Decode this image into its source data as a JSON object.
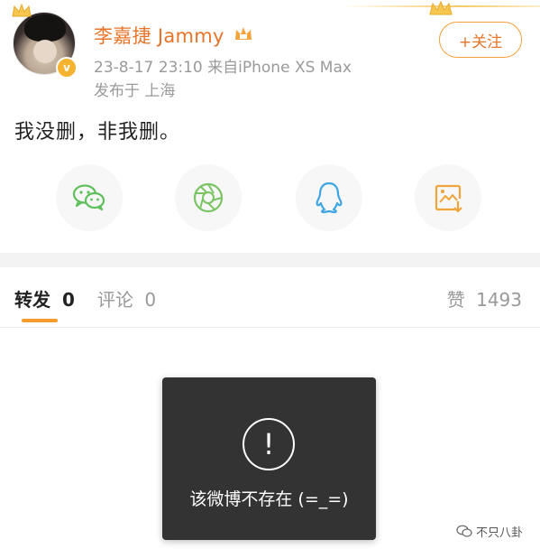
{
  "post": {
    "username": "李嘉捷 Jammy",
    "date_time": "23-8-17 23:10",
    "source": "来自iPhone XS Max",
    "location": "发布于 上海",
    "follow_label": "+关注",
    "content": "我没删，非我删。"
  },
  "share": {
    "items": [
      {
        "icon": "wechat-icon",
        "color": "#5fbf5a"
      },
      {
        "icon": "moments-icon",
        "color": "#7bc463"
      },
      {
        "icon": "qq-icon",
        "color": "#3fa6e2"
      },
      {
        "icon": "save-image-icon",
        "color": "#f0a53a"
      }
    ]
  },
  "tabs": {
    "repost": {
      "label": "转发",
      "count": "0"
    },
    "comment": {
      "label": "评论",
      "count": "0"
    },
    "like": {
      "label": "赞",
      "count": "1493"
    }
  },
  "toast": {
    "icon": "!",
    "message": "该微博不存在 (=_=)"
  },
  "watermark": {
    "text": "不只八卦"
  },
  "colors": {
    "accent": "#e8742a",
    "tab_indicator": "#f59c2f",
    "toast_bg": "#333333"
  }
}
